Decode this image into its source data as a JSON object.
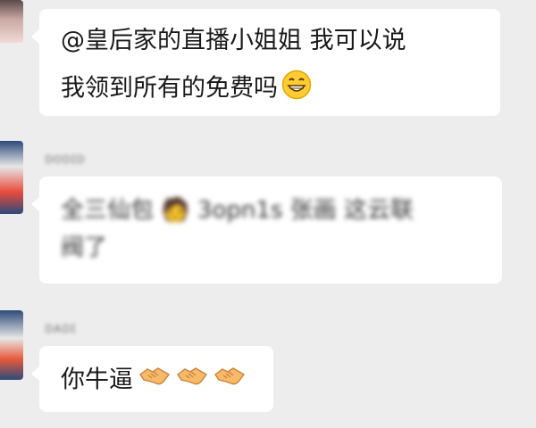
{
  "messages": [
    {
      "line1": "@皇后家的直播小姐姐  我可以说",
      "line2": "我领到所有的免费吗",
      "emoji": "grinning-face-icon"
    },
    {
      "sender": "ᴅᴏᴅɪᴅ",
      "line1": "全三仙包 🧑 3opn1s  张画 这云联",
      "line2": "阀了"
    },
    {
      "sender": "ᴅᴀᴅɪ",
      "text": "你牛逼",
      "emoji": "handshake-icon",
      "emoji_count": 3
    }
  ]
}
